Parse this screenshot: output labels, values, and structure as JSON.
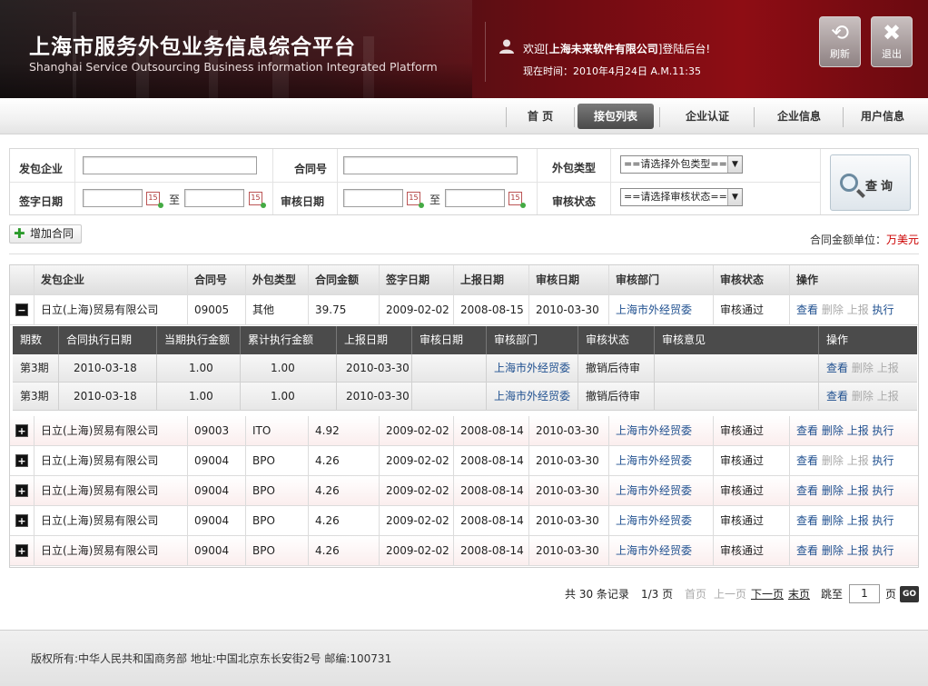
{
  "header": {
    "title_cn": "上海市服务外包业务信息综合平台",
    "title_en": "Shanghai Service Outsourcing Business information Integrated Platform",
    "welcome_prefix": "欢迎[",
    "company": "上海未来软件有限公司",
    "welcome_suffix": "]登陆后台!",
    "time": "现在时间：2010年4月24日 A.M.11:35",
    "refresh_label": "刷新",
    "logout_label": "退出"
  },
  "nav": {
    "items": [
      "首 页",
      "接包列表",
      "企业认证",
      "企业信息",
      "用户信息"
    ],
    "active": "接包列表"
  },
  "search": {
    "label_company": "发包企业",
    "label_contract": "合同号",
    "label_type": "外包类型",
    "label_sign_date": "签字日期",
    "label_review_date": "审核日期",
    "label_status": "审核状态",
    "to1": "至",
    "to2": "至",
    "type_placeholder": "==请选择外包类型==",
    "status_placeholder": "==请选择审核状态==",
    "button": "查询"
  },
  "toolbar": {
    "add_label": "增加合同",
    "unit_label": "合同金额单位：",
    "unit_value": "万美元"
  },
  "table": {
    "headers": [
      "发包企业",
      "合同号",
      "外包类型",
      "合同金额",
      "签字日期",
      "上报日期",
      "审核日期",
      "审核部门",
      "审核状态",
      "操作"
    ],
    "rows": [
      {
        "company": "日立(上海)贸易有限公司",
        "no": "09005",
        "type": "其他",
        "amount": "39.75",
        "sign": "2009-02-02",
        "report": "2008-08-15",
        "review": "2010-03-30",
        "dept": "上海市外经贸委",
        "status": "审核通过",
        "expanded": true,
        "delete_enabled": false,
        "report_enabled": false
      },
      {
        "company": "日立(上海)贸易有限公司",
        "no": "09003",
        "type": "ITO",
        "amount": "4.92",
        "sign": "2009-02-02",
        "report": "2008-08-14",
        "review": "2010-03-30",
        "dept": "上海市外经贸委",
        "status": "审核通过",
        "expanded": false,
        "delete_enabled": true,
        "report_enabled": true
      },
      {
        "company": "日立(上海)贸易有限公司",
        "no": "09004",
        "type": "BPO",
        "amount": "4.26",
        "sign": "2009-02-02",
        "report": "2008-08-14",
        "review": "2010-03-30",
        "dept": "上海市外经贸委",
        "status": "审核通过",
        "expanded": false,
        "delete_enabled": false,
        "report_enabled": false
      },
      {
        "company": "日立(上海)贸易有限公司",
        "no": "09004",
        "type": "BPO",
        "amount": "4.26",
        "sign": "2009-02-02",
        "report": "2008-08-14",
        "review": "2010-03-30",
        "dept": "上海市外经贸委",
        "status": "审核通过",
        "expanded": false,
        "delete_enabled": true,
        "report_enabled": true
      },
      {
        "company": "日立(上海)贸易有限公司",
        "no": "09004",
        "type": "BPO",
        "amount": "4.26",
        "sign": "2009-02-02",
        "report": "2008-08-14",
        "review": "2010-03-30",
        "dept": "上海市外经贸委",
        "status": "审核通过",
        "expanded": false,
        "delete_enabled": true,
        "report_enabled": true
      },
      {
        "company": "日立(上海)贸易有限公司",
        "no": "09004",
        "type": "BPO",
        "amount": "4.26",
        "sign": "2009-02-02",
        "report": "2008-08-14",
        "review": "2010-03-30",
        "dept": "上海市外经贸委",
        "status": "审核通过",
        "expanded": false,
        "delete_enabled": true,
        "report_enabled": true
      }
    ],
    "actions": {
      "view": "查看",
      "delete": "删除",
      "report": "上报",
      "execute": "执行"
    }
  },
  "subtable": {
    "headers": [
      "期数",
      "合同执行日期",
      "当期执行金额",
      "累计执行金额",
      "上报日期",
      "审核日期",
      "审核部门",
      "审核状态",
      "审核意见",
      "操作"
    ],
    "rows": [
      {
        "period": "第3期",
        "date": "2010-03-18",
        "cur": "1.00",
        "total": "1.00",
        "report": "2010-03-30",
        "review": "",
        "dept": "上海市外经贸委",
        "status": "撤销后待审",
        "opinion": ""
      },
      {
        "period": "第3期",
        "date": "2010-03-18",
        "cur": "1.00",
        "total": "1.00",
        "report": "2010-03-30",
        "review": "",
        "dept": "上海市外经贸委",
        "status": "撤销后待审",
        "opinion": ""
      }
    ]
  },
  "pager": {
    "total": "共 30 条记录",
    "page": "1/3 页",
    "first": "首页",
    "prev": "上一页",
    "next": "下一页",
    "last": "末页",
    "jump_label": "跳至",
    "jump_value": "1",
    "page_unit": "页",
    "go": "GO"
  },
  "footer": {
    "text": "版权所有:中华人民共和国商务部 地址:中国北京东长安街2号 邮编:100731"
  }
}
